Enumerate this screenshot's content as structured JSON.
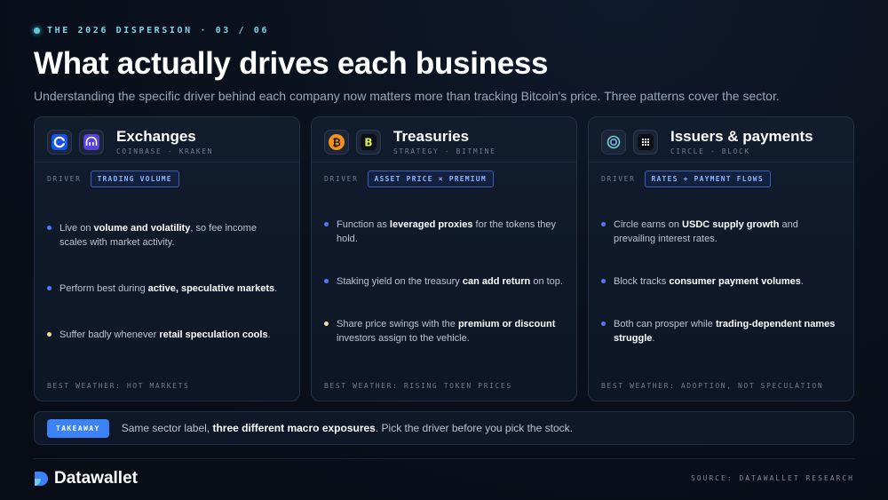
{
  "eyebrow": "THE 2026 DISPERSION · 03 / 06",
  "title": "What actually drives each business",
  "subtitle": "Understanding the specific driver behind each company now matters more than tracking Bitcoin's price. Three patterns cover the sector.",
  "colors": {
    "accent": "#3b82f6",
    "cyan": "#5cc8dc",
    "badge_text": "#8db4ff",
    "bullet_blue": "#4f7cff",
    "bullet_yellow": "#f2e6a0",
    "background": "#0a111d"
  },
  "cards": [
    {
      "title": "Exchanges",
      "subtitle": "COINBASE · KRAKEN",
      "icons": [
        "coinbase-logo",
        "kraken-logo"
      ],
      "driver_label": "DRIVER",
      "driver": "TRADING VOLUME",
      "bullets": [
        {
          "pre": "Live on ",
          "bold": "volume and volatility",
          "post": ", so fee income scales with market activity."
        },
        {
          "pre": "Perform best during ",
          "bold": "active, speculative markets",
          "post": "."
        },
        {
          "pre": "Suffer badly whenever ",
          "bold": "retail speculation cools",
          "post": "."
        }
      ],
      "footer": "BEST WEATHER: HOT MARKETS"
    },
    {
      "title": "Treasuries",
      "subtitle": "STRATEGY · BITMINE",
      "icons": [
        "bitcoin-logo",
        "bitmine-logo"
      ],
      "driver_label": "DRIVER",
      "driver": "ASSET PRICE × PREMIUM",
      "bullets": [
        {
          "pre": "Function as ",
          "bold": "leveraged proxies",
          "post": " for the tokens they hold."
        },
        {
          "pre": "Staking yield on the treasury ",
          "bold": "can add return",
          "post": " on top."
        },
        {
          "pre": "Share price swings with the ",
          "bold": "premium or discount",
          "post": " investors assign to the vehicle."
        }
      ],
      "footer": "BEST WEATHER: RISING TOKEN PRICES"
    },
    {
      "title": "Issuers & payments",
      "subtitle": "CIRCLE · BLOCK",
      "icons": [
        "circle-logo",
        "block-logo"
      ],
      "driver_label": "DRIVER",
      "driver": "RATES + PAYMENT FLOWS",
      "bullets": [
        {
          "pre": "Circle earns on ",
          "bold": "USDC supply growth",
          "post": " and prevailing interest rates."
        },
        {
          "pre": "Block tracks ",
          "bold": "consumer payment volumes",
          "post": "."
        },
        {
          "pre": "Both can prosper while ",
          "bold": "trading-dependent names struggle",
          "post": "."
        }
      ],
      "footer": "BEST WEATHER: ADOPTION, NOT SPECULATION"
    }
  ],
  "takeaway": {
    "label": "TAKEAWAY",
    "pre": "Same sector label, ",
    "bold": "three different macro exposures",
    "post": ". Pick the driver before you pick the stock."
  },
  "brand": "Datawallet",
  "source": "SOURCE: DATAWALLET RESEARCH"
}
